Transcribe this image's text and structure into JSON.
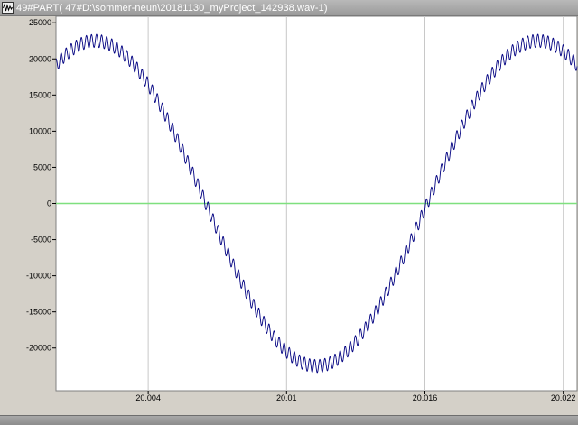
{
  "window": {
    "title": "49#PART( 47#D:\\sommer-neun\\20181130_myProject_142938.wav-1)",
    "icon": "waveform-app-icon"
  },
  "colors": {
    "plot_background": "#ffffff",
    "waveform": "#000080",
    "zero_line": "#7fe07f",
    "grid": "#c8c8c8",
    "chrome": "#d4d0c8"
  },
  "chart_data": {
    "type": "line",
    "title": "",
    "xlabel": "",
    "ylabel": "",
    "xlim": [
      20.0,
      20.0226
    ],
    "ylim": [
      -25900,
      25900
    ],
    "x_ticks": [
      20.004,
      20.01,
      20.016,
      20.022
    ],
    "x_tick_labels": [
      "20.004",
      "20.01",
      "20.016",
      "20.022"
    ],
    "y_ticks": [
      25000,
      20000,
      15000,
      10000,
      5000,
      0,
      -5000,
      -10000,
      -15000,
      -20000
    ],
    "y_tick_labels": [
      "25000",
      "20000",
      "15000",
      "10000",
      "5000",
      "0",
      "-5000",
      "-10000",
      "-15000",
      "-20000"
    ],
    "grid": true,
    "zero_line": true,
    "series": [
      {
        "components": [
          {
            "amplitude": 22500,
            "period": 0.0192,
            "peak_at": 20.0017
          },
          {
            "amplitude": 900,
            "period": 0.00022,
            "peak_at": 20.0
          }
        ]
      }
    ]
  }
}
